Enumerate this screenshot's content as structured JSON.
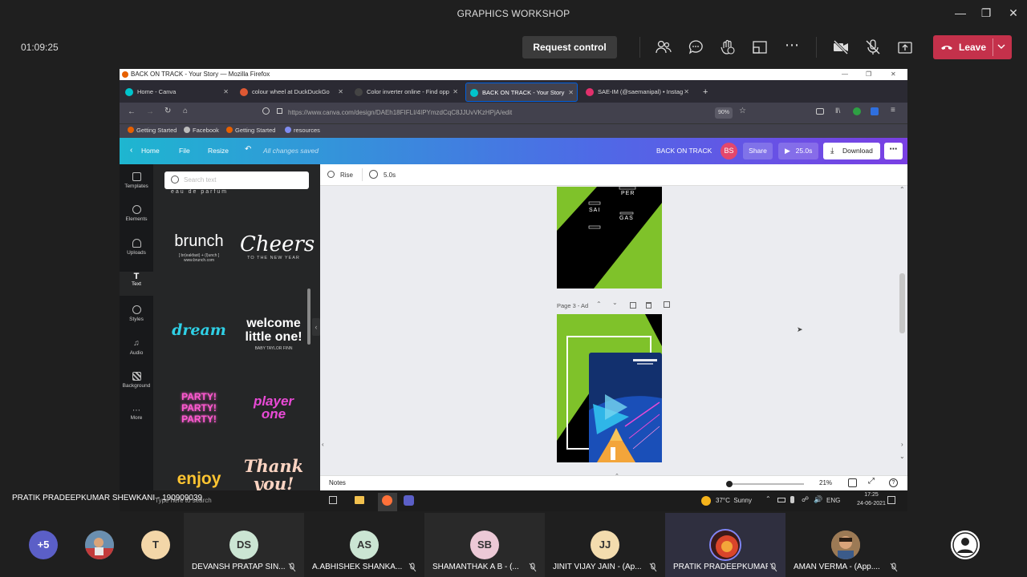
{
  "teams": {
    "window_title": "GRAPHICS WORKSHOP",
    "timer": "01:09:25",
    "request_control": "Request control",
    "leave_label": "Leave",
    "presenter_label": "PRATIK PRADEEPKUMAR SHEWKANI - 190909039",
    "more_count": "+5",
    "participants": [
      {
        "initials": "",
        "name": "",
        "color": "#8b6b4a"
      },
      {
        "initials": "T",
        "name": "",
        "color": "#f3d6a8"
      },
      {
        "initials": "DS",
        "name": "DEVANSH PRATAP SIN...",
        "color": "#cbe5d3"
      },
      {
        "initials": "AS",
        "name": "A.ABHISHEK SHANKA...",
        "color": "#cbe5d3"
      },
      {
        "initials": "SB",
        "name": "SHAMANTHAK A B - (...",
        "color": "#ecc9d6"
      },
      {
        "initials": "JJ",
        "name": "JINIT VIJAY JAIN - (Ap...",
        "color": "#f3dcae"
      },
      {
        "initials": "",
        "name": "PRATIK PRADEEPKUMAR S...",
        "color": "#c0392b"
      },
      {
        "initials": "",
        "name": "AMAN VERMA - (App....",
        "color": "#c99a6a"
      }
    ]
  },
  "firefox": {
    "title": "BACK ON TRACK - Your Story — Mozilla Firefox",
    "tabs": [
      {
        "label": "Home - Canva",
        "color": "#00c4cc"
      },
      {
        "label": "colour wheel at DuckDuckGo",
        "color": "#de5833"
      },
      {
        "label": "Color inverter online - Find opp",
        "color": "#444"
      },
      {
        "label": "BACK ON TRACK - Your Story",
        "color": "#00c4cc"
      },
      {
        "label": "SAE-IM (@saemanipal) • Instag",
        "color": "#e1306c"
      }
    ],
    "url": "https://www.canva.com/design/DAEh18FIFLI/4IPYmzdCqC8JJUvVKzHPjA/edit",
    "zoom": "90%",
    "bookmarks": [
      "Getting Started",
      "Facebook",
      "Getting Started",
      "resources"
    ]
  },
  "canva": {
    "home": "Home",
    "file": "File",
    "resize": "Resize",
    "saved": "All changes saved",
    "design_title": "BACK ON TRACK",
    "avatar_initials": "BS",
    "share": "Share",
    "duration": "25.0s",
    "download": "Download",
    "rail": [
      "Templates",
      "Elements",
      "Uploads",
      "Text",
      "Styles",
      "Audio",
      "Background",
      "More"
    ],
    "search_placeholder": "Search text",
    "samples": {
      "eau": "eau de parfum",
      "brunch": "brunch",
      "brunch_sub": "[ br(eakfast) + (l)unch ]",
      "brunch_url": "www.brunch.com",
      "cheers": "Cheers",
      "cheers_sub": "TO THE NEW YEAR",
      "dream": "dream",
      "welcome": "welcome little one!",
      "welcome_sub": "BABY TAYLOR FINN",
      "party": "PARTY! PARTY! PARTY!",
      "player": "player one",
      "enjoy": "enjoy",
      "thank": "Thank you!"
    },
    "animation": "Rise",
    "time": "5.0s",
    "page3_label": "Page 3 - Ad",
    "page2_words": [
      "PER",
      "SAI",
      "GAS"
    ],
    "notes": "Notes",
    "zoom": "21%"
  },
  "win_taskbar": {
    "search": "Type here to search",
    "weather": "37°C  Sunny",
    "lang": "ENG",
    "time": "17:25",
    "date": "24-06-2021"
  }
}
